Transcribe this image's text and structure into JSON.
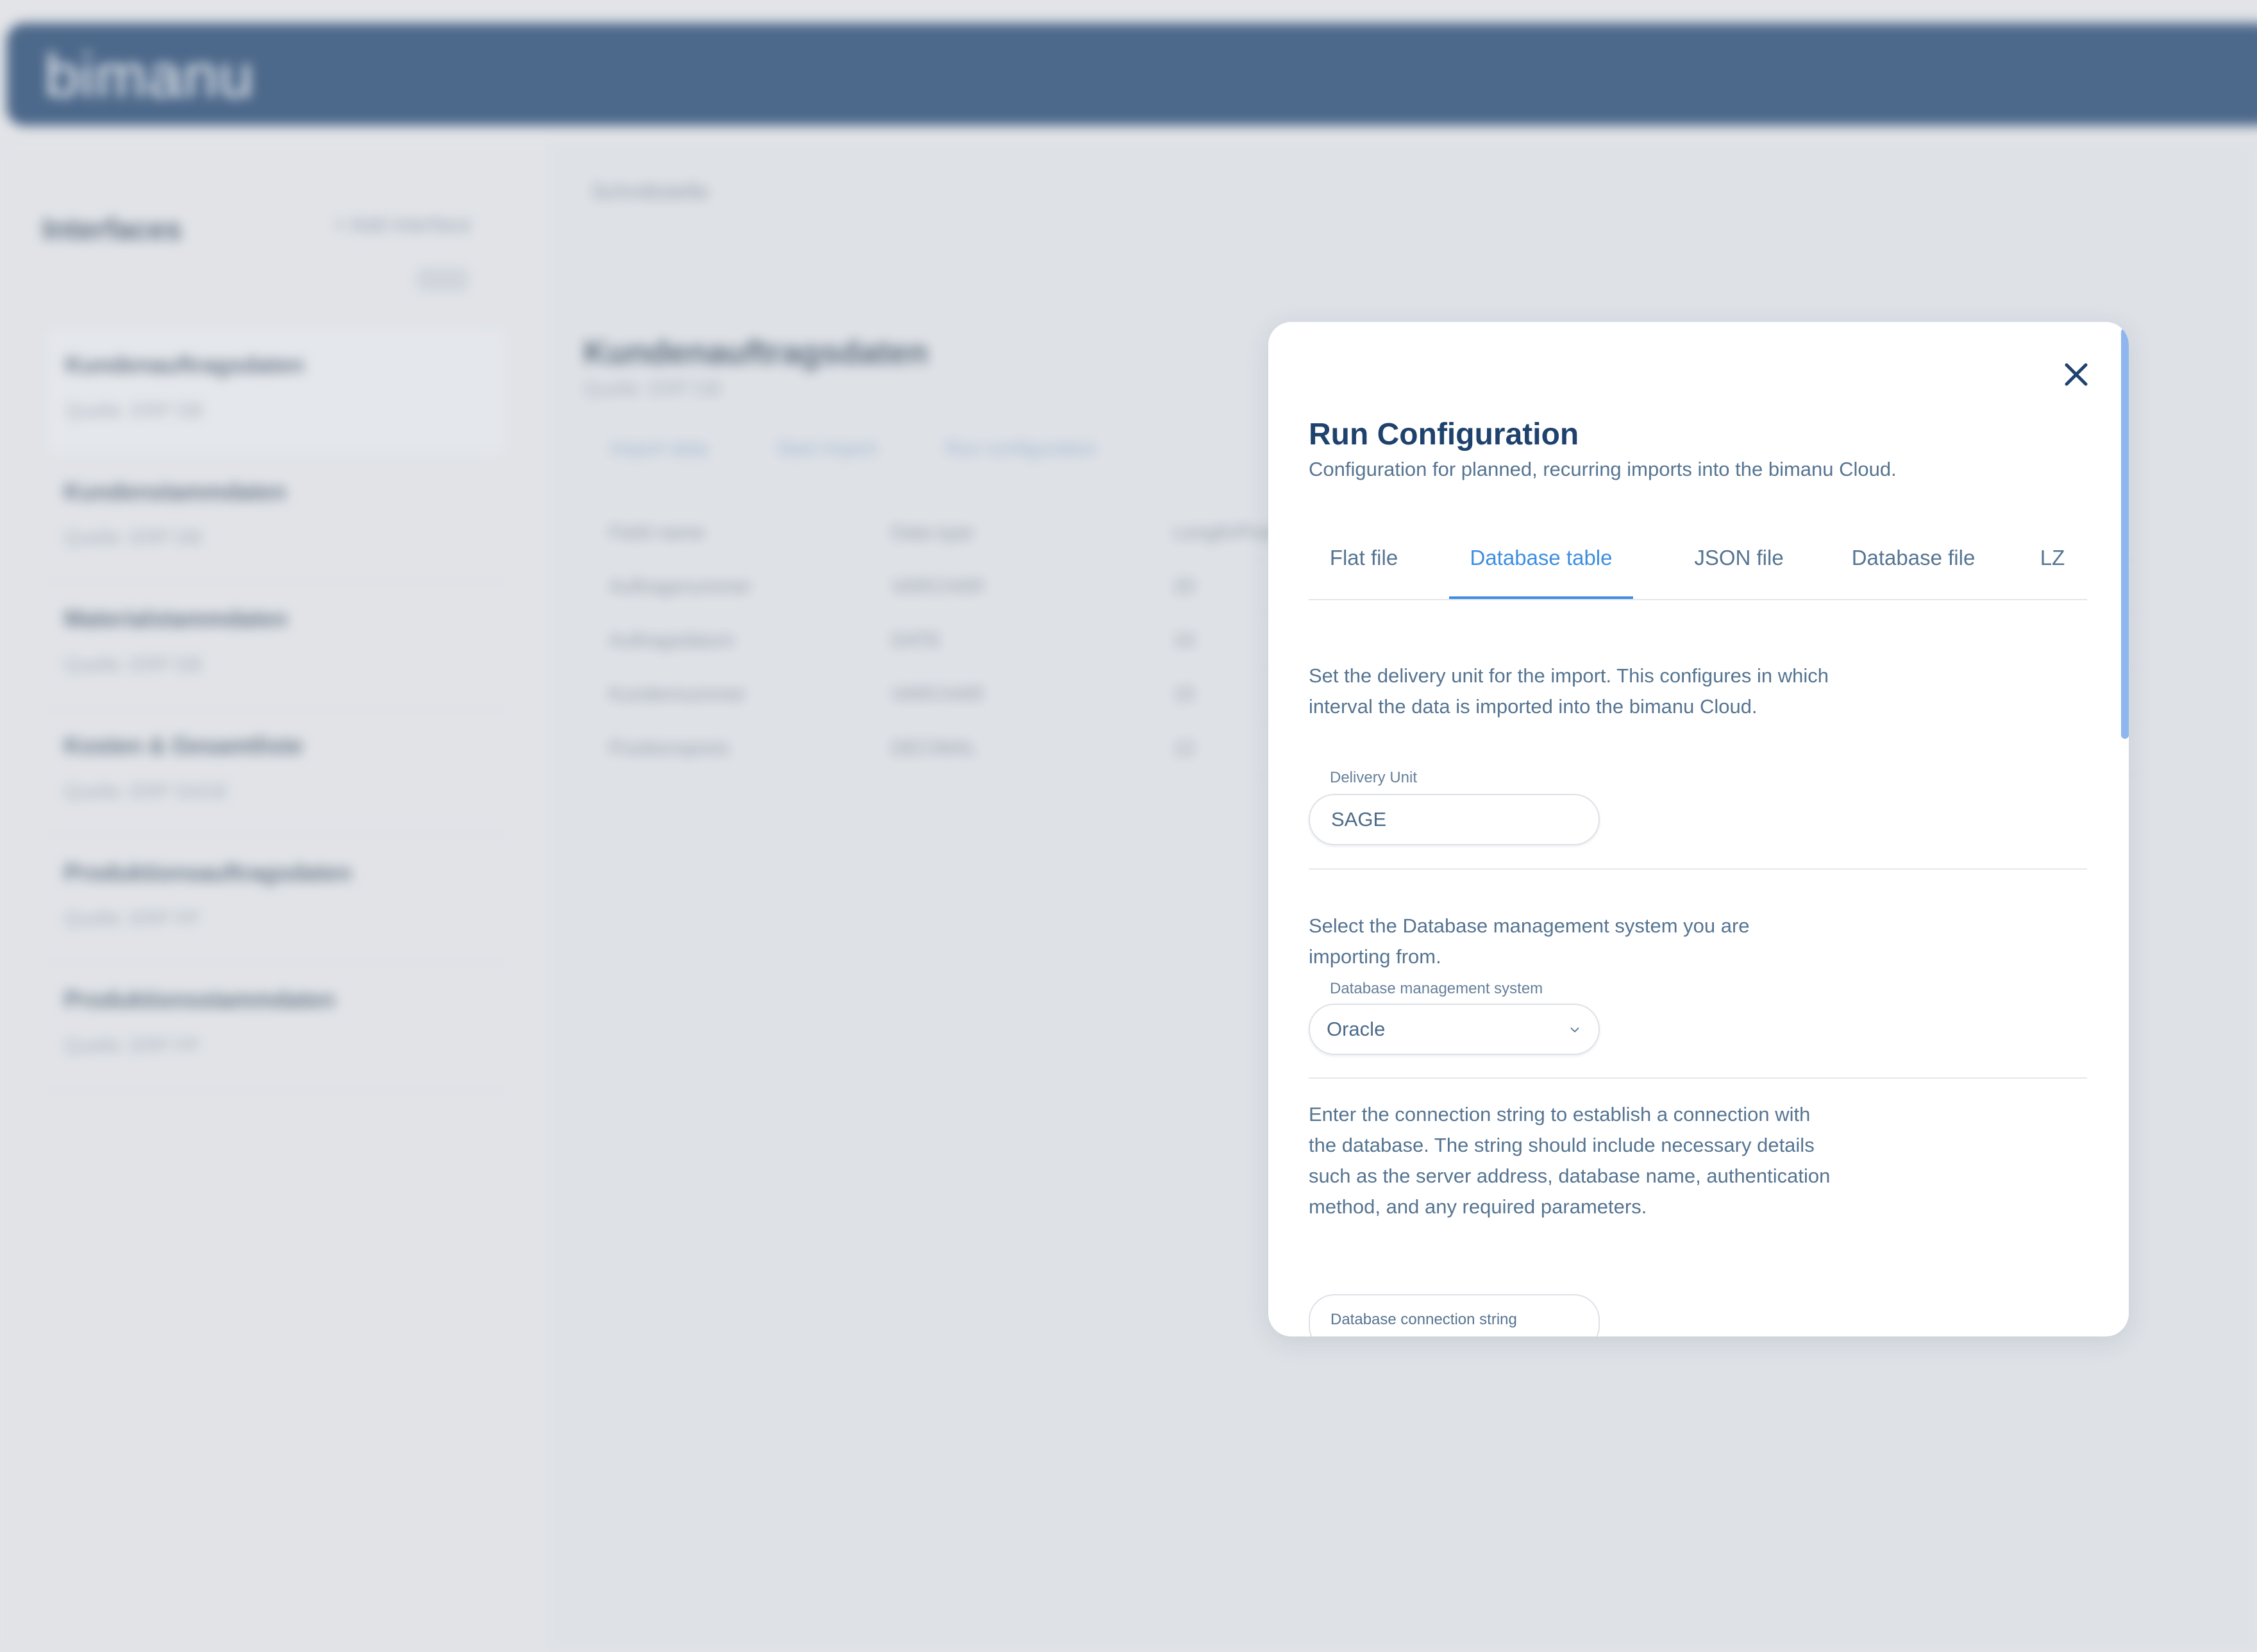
{
  "app": {
    "logo": "bimanu"
  },
  "sidebar": {
    "title": "Interfaces",
    "add_label": "+ Add interface",
    "filter_label": "All",
    "items": [
      {
        "name": "Kundenauftragsdaten",
        "sub": "Quelle: ERP DB"
      },
      {
        "name": "Kundenstammdaten",
        "sub": "Quelle: ERP DB"
      },
      {
        "name": "Materialstammdaten",
        "sub": "Quelle: ERP DB"
      },
      {
        "name": "Kosten & Gesamtliste",
        "sub": "Quelle: ERP SAGE"
      },
      {
        "name": "Produktionsauftragsdaten",
        "sub": "Quelle: ERP FP"
      },
      {
        "name": "Produktionsstammdaten",
        "sub": "Quelle: ERP FP"
      }
    ]
  },
  "content": {
    "breadcrumb": "Schnittstelle",
    "title": "Kundenauftragsdaten",
    "subtitle": "Quelle: ERP DB",
    "buttons": [
      "Import data",
      "Start import",
      "Run configuration"
    ],
    "table_header": [
      "Field name",
      "Data type",
      "Length/Precision"
    ],
    "rows": [
      [
        "Auftragsnummer",
        "VARCHAR",
        "20"
      ],
      [
        "Auftragsdatum",
        "DATE",
        "10"
      ],
      [
        "Kundennummer",
        "VARCHAR",
        "15"
      ],
      [
        "Positionspreis",
        "DECIMAL",
        "12"
      ]
    ]
  },
  "modal": {
    "title": "Run Configuration",
    "subtitle": "Configuration for planned, recurring imports into the bimanu Cloud.",
    "tabs": [
      {
        "label": "Flat file"
      },
      {
        "label": "Database table"
      },
      {
        "label": "JSON file"
      },
      {
        "label": "Database file"
      },
      {
        "label": "LZ"
      }
    ],
    "active_tab": "Database table",
    "delivery": {
      "description": "Set the delivery unit for the import. This configures in which interval the data is imported into the bimanu Cloud.",
      "label": "Delivery Unit",
      "value": "SAGE"
    },
    "dbms": {
      "description": "Select the Database management system you are importing from.",
      "label": "Database management system",
      "value": "Oracle"
    },
    "connection": {
      "description": "Enter the connection string to establish a connection with the database. The string should include necessary details such as the server address, database name, authentication method, and any required parameters.",
      "label": "Database connection string"
    }
  },
  "colors": {
    "primary_dark": "#1e426d",
    "accent": "#3d8ee0",
    "text": "#557491"
  },
  "icons": {
    "close": "close-icon",
    "dropdown": "chevron-down-icon"
  }
}
